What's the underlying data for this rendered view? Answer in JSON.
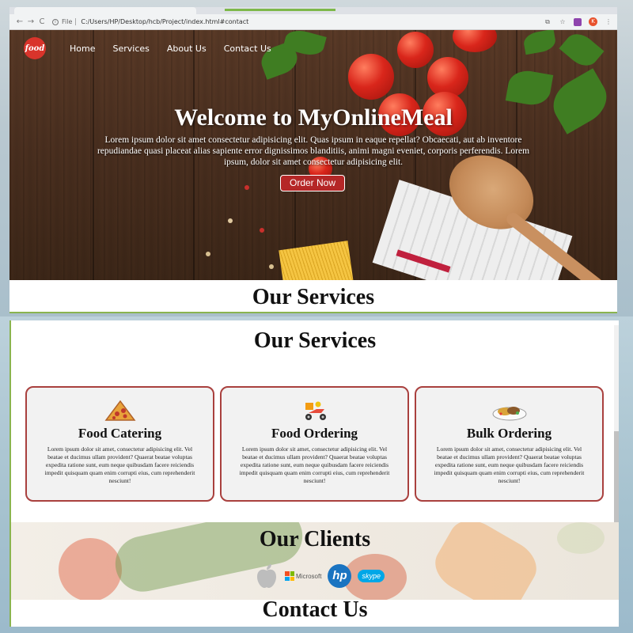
{
  "browser": {
    "nav_back": "←",
    "nav_forward": "→",
    "nav_reload": "C",
    "file_tag": "File",
    "url": "C:/Users/HP/Desktop/hcb/Project/index.html#contact"
  },
  "site": {
    "logo_text": "food",
    "nav": [
      "Home",
      "Services",
      "About Us",
      "Contact Us"
    ],
    "hero": {
      "title": "Welcome to MyOnlineMeal",
      "text": "Lorem ipsum dolor sit amet consectetur adipisicing elit. Quas ipsum in eaque repellat? Obcaecati, aut ab inventore repudiandae quasi placeat alias sapiente error dignissimos blanditiis, animi magni eveniet, corporis perferendis. Lorem ipsum, dolor sit amet consectetur adipisicing elit.",
      "button": "Order Now"
    },
    "services": {
      "title": "Our Services",
      "cards": [
        {
          "title": "Food Catering",
          "icon": "pizza-icon",
          "text": "Lorem ipsum dolor sit amet, consectetur adipisicing elit. Vel beatae et ducimus ullam provident? Quaerat beatae voluptas expedita ratione sunt, eum neque quibusdam facere reiciendis impedit quisquam quam enim corrupti eius, cum reprehenderit nesciunt!"
        },
        {
          "title": "Food Ordering",
          "icon": "delivery-scooter-icon",
          "text": "Lorem ipsum dolor sit amet, consectetur adipisicing elit. Vel beatae et ducimus ullam provident? Quaerat beatae voluptas expedita ratione sunt, eum neque quibusdam facere reiciendis impedit quisquam quam enim corrupti eius, cum reprehenderit nesciunt!"
        },
        {
          "title": "Bulk Ordering",
          "icon": "food-plate-icon",
          "text": "Lorem ipsum dolor sit amet, consectetur adipisicing elit. Vel beatae et ducimus ullam provident? Quaerat beatae voluptas expedita ratione sunt, eum neque quibusdam facere reiciendis impedit quisquam quam enim corrupti eius, cum reprehenderit nesciunt!"
        }
      ]
    },
    "clients": {
      "title": "Our Clients",
      "logos": [
        {
          "name": "apple-logo"
        },
        {
          "name": "microsoft-logo",
          "label": "Microsoft"
        },
        {
          "name": "hp-logo",
          "label": "hp"
        },
        {
          "name": "skype-logo",
          "label": "skype"
        }
      ]
    },
    "contact": {
      "title": "Contact Us"
    }
  },
  "colors": {
    "accent_red": "#b52727",
    "card_border": "#a9403e",
    "panel_border": "#8ab44f"
  }
}
